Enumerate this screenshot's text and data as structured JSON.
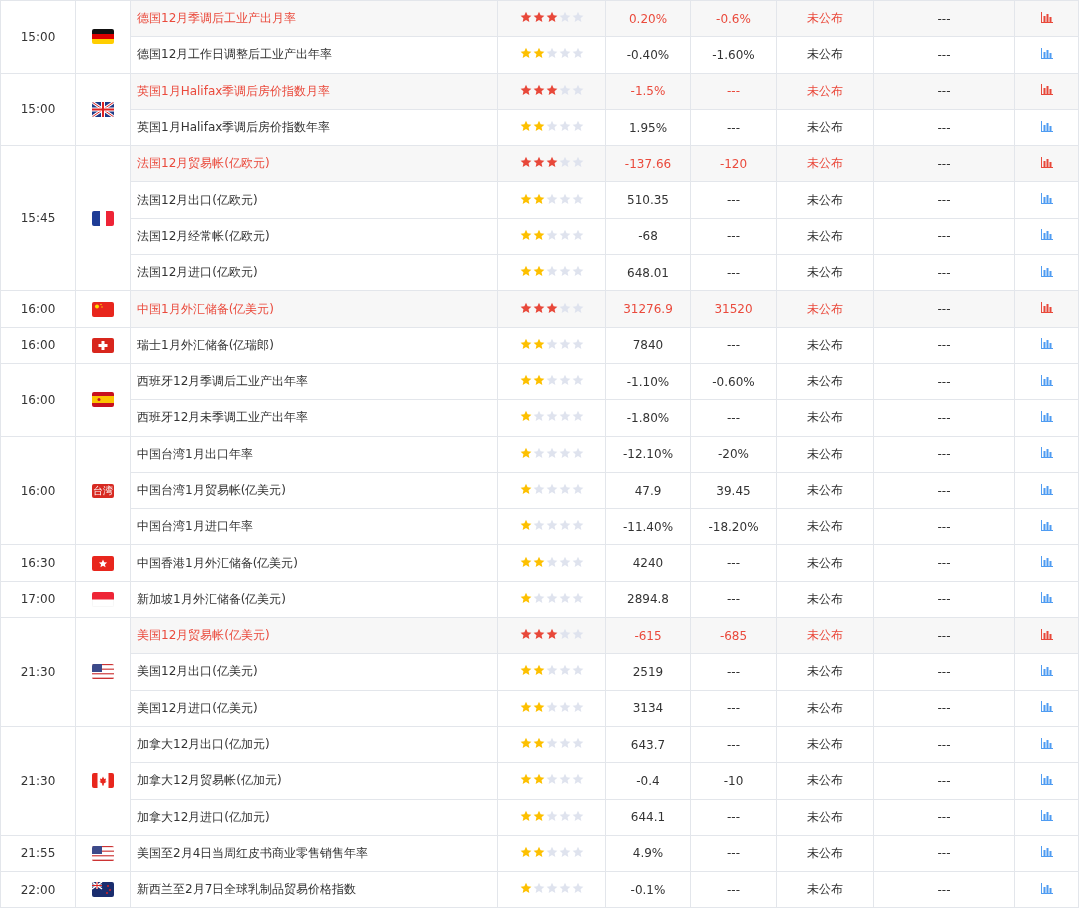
{
  "groups": [
    {
      "time": "15:00",
      "kind": "de",
      "events": [
        {
          "name": "德国12月季调后工业产出月率",
          "important": true,
          "stars": 3,
          "column_5": "0.20%",
          "column_6": "-0.6%",
          "column_7": "未公布",
          "column_8": "---"
        },
        {
          "name": "德国12月工作日调整后工业产出年率",
          "important": false,
          "stars": 2,
          "column_5": "-0.40%",
          "column_6": "-1.60%",
          "column_7": "未公布",
          "column_8": "---"
        }
      ]
    },
    {
      "time": "15:00",
      "kind": "gb",
      "events": [
        {
          "name": "英国1月Halifax季调后房价指数月率",
          "important": true,
          "stars": 3,
          "column_5": "-1.5%",
          "column_6": "---",
          "column_7": "未公布",
          "column_8": "---"
        },
        {
          "name": "英国1月Halifax季调后房价指数年率",
          "important": false,
          "stars": 2,
          "column_5": "1.95%",
          "column_6": "---",
          "column_7": "未公布",
          "column_8": "---"
        }
      ]
    },
    {
      "time": "15:45",
      "kind": "fr",
      "events": [
        {
          "name": "法国12月贸易帐(亿欧元)",
          "important": true,
          "stars": 3,
          "column_5": "-137.66",
          "column_6": "-120",
          "column_7": "未公布",
          "column_8": "---"
        },
        {
          "name": "法国12月出口(亿欧元)",
          "important": false,
          "stars": 2,
          "column_5": "510.35",
          "column_6": "---",
          "column_7": "未公布",
          "column_8": "---"
        },
        {
          "name": "法国12月经常帐(亿欧元)",
          "important": false,
          "stars": 2,
          "column_5": "-68",
          "column_6": "---",
          "column_7": "未公布",
          "column_8": "---"
        },
        {
          "name": "法国12月进口(亿欧元)",
          "important": false,
          "stars": 2,
          "column_5": "648.01",
          "column_6": "---",
          "column_7": "未公布",
          "column_8": "---"
        }
      ]
    },
    {
      "time": "16:00",
      "kind": "cn",
      "events": [
        {
          "name": "中国1月外汇储备(亿美元)",
          "important": true,
          "stars": 3,
          "column_5": "31276.9",
          "column_6": "31520",
          "column_7": "未公布",
          "column_8": "---"
        }
      ]
    },
    {
      "time": "16:00",
      "kind": "ch",
      "events": [
        {
          "name": "瑞士1月外汇储备(亿瑞郎)",
          "important": false,
          "stars": 2,
          "column_5": "7840",
          "column_6": "---",
          "column_7": "未公布",
          "column_8": "---"
        }
      ]
    },
    {
      "time": "16:00",
      "kind": "es",
      "events": [
        {
          "name": "西班牙12月季调后工业产出年率",
          "important": false,
          "stars": 2,
          "column_5": "-1.10%",
          "column_6": "-0.60%",
          "column_7": "未公布",
          "column_8": "---"
        },
        {
          "name": "西班牙12月未季调工业产出年率",
          "important": false,
          "stars": 1,
          "column_5": "-1.80%",
          "column_6": "---",
          "column_7": "未公布",
          "column_8": "---"
        }
      ]
    },
    {
      "time": "16:00",
      "kind": "label",
      "flag_text": "台湾",
      "events": [
        {
          "name": "中国台湾1月出口年率",
          "important": false,
          "stars": 1,
          "column_5": "-12.10%",
          "column_6": "-20%",
          "column_7": "未公布",
          "column_8": "---"
        },
        {
          "name": "中国台湾1月贸易帐(亿美元)",
          "important": false,
          "stars": 1,
          "column_5": "47.9",
          "column_6": "39.45",
          "column_7": "未公布",
          "column_8": "---"
        },
        {
          "name": "中国台湾1月进口年率",
          "important": false,
          "stars": 1,
          "column_5": "-11.40%",
          "column_6": "-18.20%",
          "column_7": "未公布",
          "column_8": "---"
        }
      ]
    },
    {
      "time": "16:30",
      "kind": "hk",
      "events": [
        {
          "name": "中国香港1月外汇储备(亿美元)",
          "important": false,
          "stars": 2,
          "column_5": "4240",
          "column_6": "---",
          "column_7": "未公布",
          "column_8": "---"
        }
      ]
    },
    {
      "time": "17:00",
      "kind": "sg",
      "events": [
        {
          "name": "新加坡1月外汇储备(亿美元)",
          "important": false,
          "stars": 1,
          "column_5": "2894.8",
          "column_6": "---",
          "column_7": "未公布",
          "column_8": "---"
        }
      ]
    },
    {
      "time": "21:30",
      "kind": "us",
      "events": [
        {
          "name": "美国12月贸易帐(亿美元)",
          "important": true,
          "stars": 3,
          "column_5": "-615",
          "column_6": "-685",
          "column_7": "未公布",
          "column_8": "---"
        },
        {
          "name": "美国12月出口(亿美元)",
          "important": false,
          "stars": 2,
          "column_5": "2519",
          "column_6": "---",
          "column_7": "未公布",
          "column_8": "---"
        },
        {
          "name": "美国12月进口(亿美元)",
          "important": false,
          "stars": 2,
          "column_5": "3134",
          "column_6": "---",
          "column_7": "未公布",
          "column_8": "---"
        }
      ]
    },
    {
      "time": "21:30",
      "kind": "ca",
      "events": [
        {
          "name": "加拿大12月出口(亿加元)",
          "important": false,
          "stars": 2,
          "column_5": "643.7",
          "column_6": "---",
          "column_7": "未公布",
          "column_8": "---"
        },
        {
          "name": "加拿大12月贸易帐(亿加元)",
          "important": false,
          "stars": 2,
          "column_5": "-0.4",
          "column_6": "-10",
          "column_7": "未公布",
          "column_8": "---"
        },
        {
          "name": "加拿大12月进口(亿加元)",
          "important": false,
          "stars": 2,
          "column_5": "644.1",
          "column_6": "---",
          "column_7": "未公布",
          "column_8": "---"
        }
      ]
    },
    {
      "time": "21:55",
      "kind": "us",
      "events": [
        {
          "name": "美国至2月4日当周红皮书商业零售销售年率",
          "important": false,
          "stars": 2,
          "column_5": "4.9%",
          "column_6": "---",
          "column_7": "未公布",
          "column_8": "---"
        }
      ]
    },
    {
      "time": "22:00",
      "kind": "nz",
      "events": [
        {
          "name": "新西兰至2月7日全球乳制品贸易价格指数",
          "important": false,
          "stars": 1,
          "column_5": "-0.1%",
          "column_6": "---",
          "column_7": "未公布",
          "column_8": "---"
        }
      ]
    }
  ]
}
